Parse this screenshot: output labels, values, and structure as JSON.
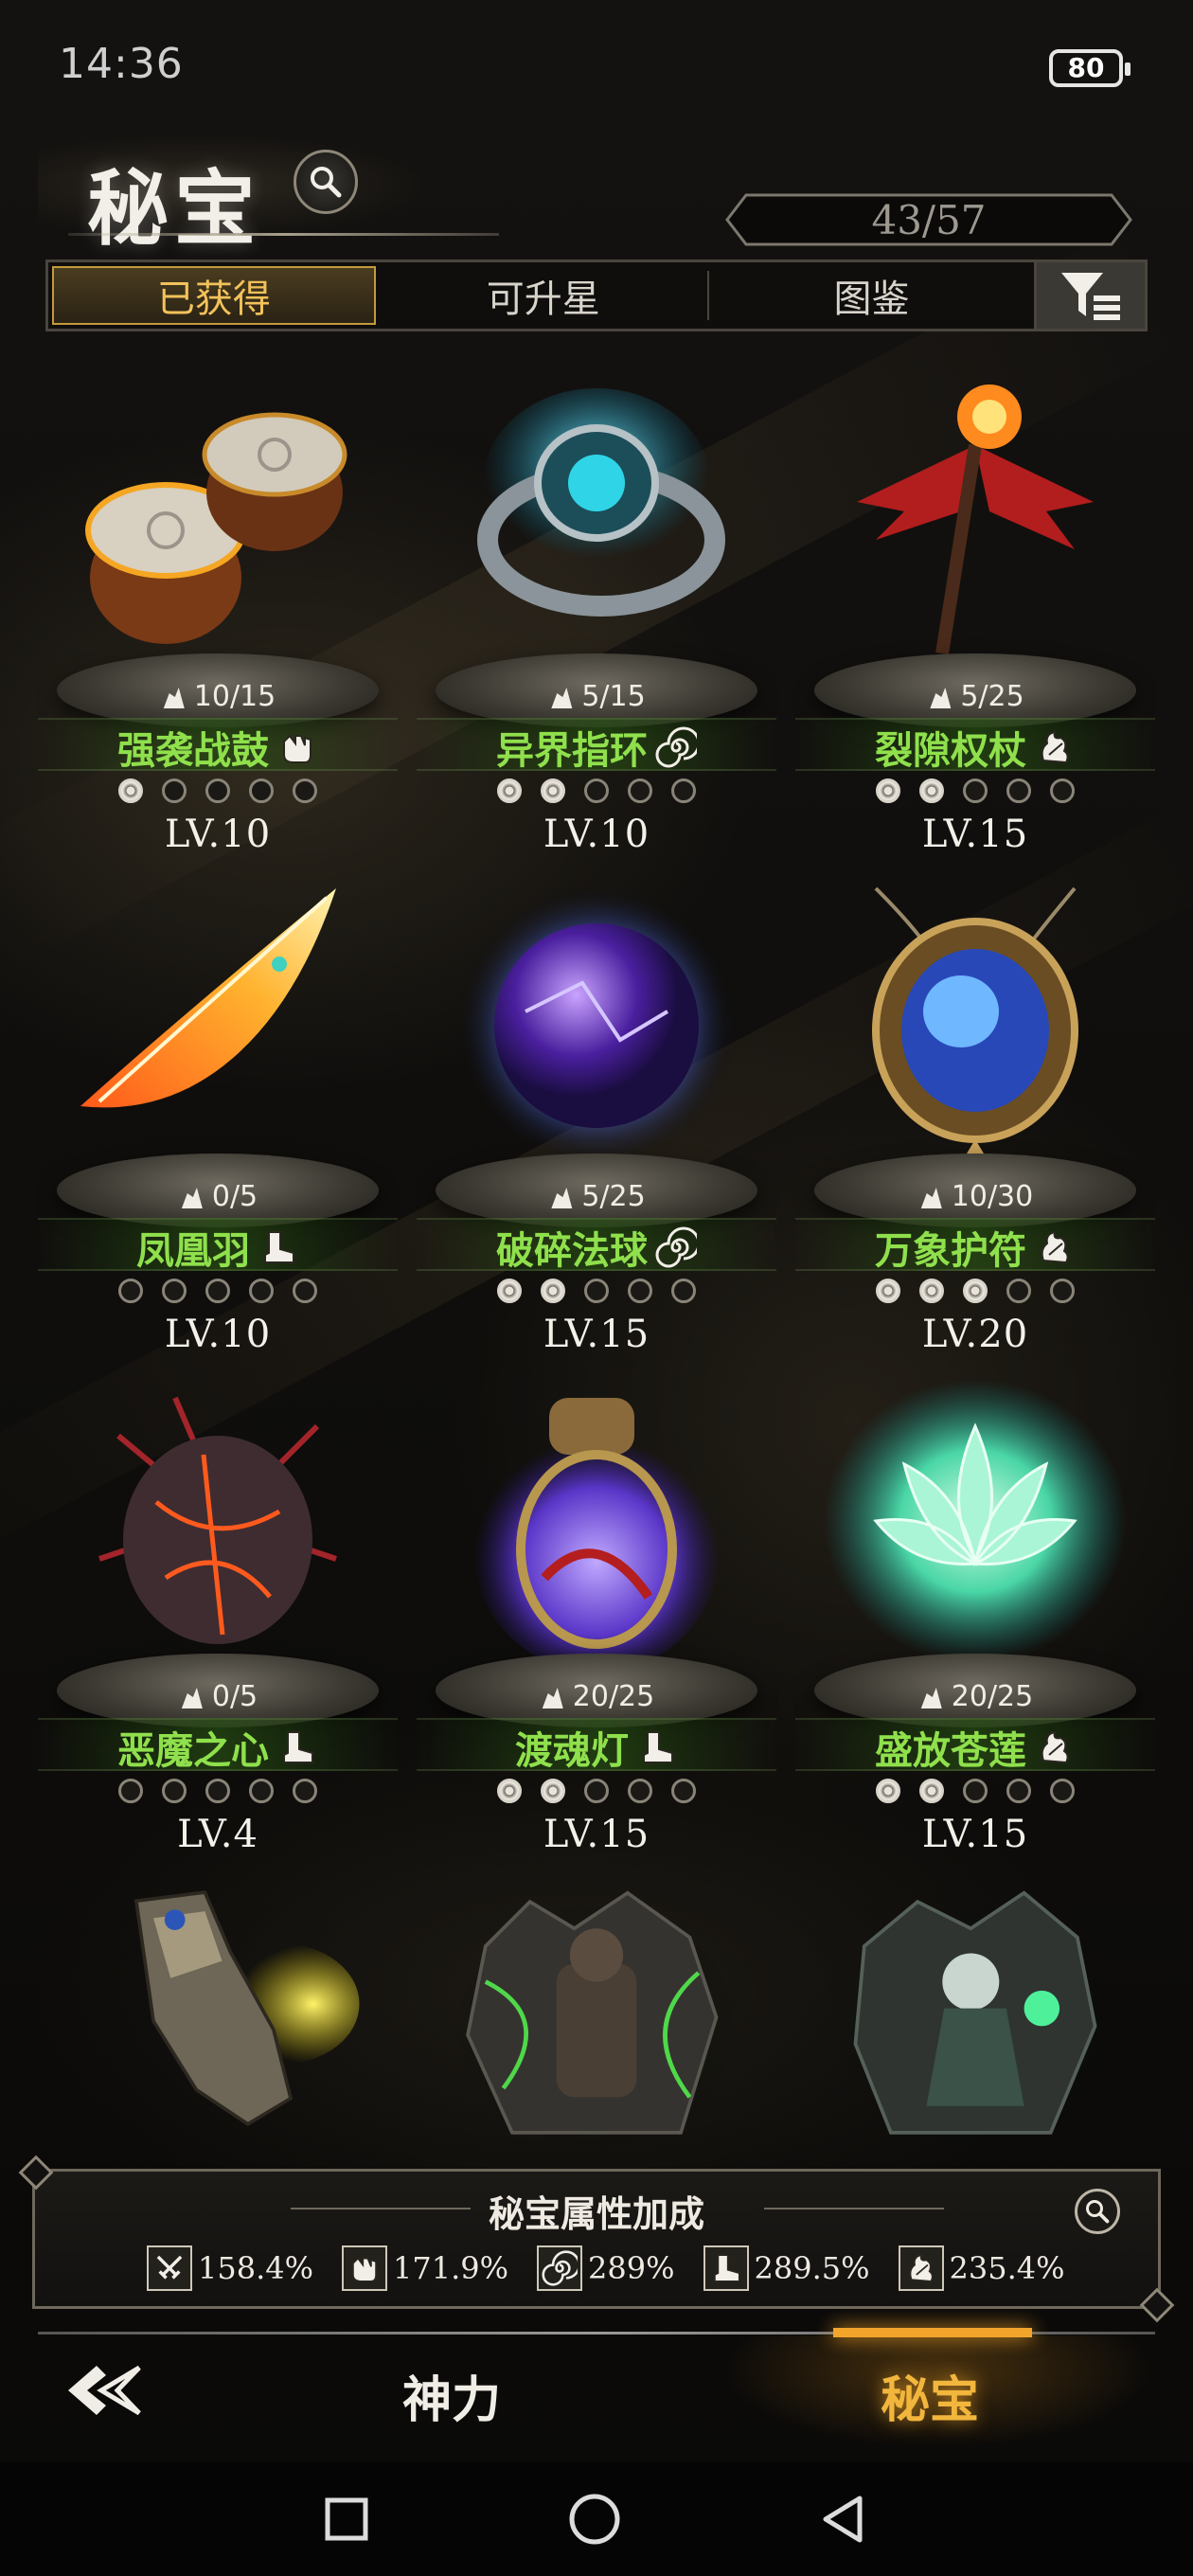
{
  "status_bar": {
    "time": "14:36",
    "battery": "80"
  },
  "header": {
    "title": "秘宝",
    "counter": "43/57"
  },
  "tabs": [
    {
      "label": "已获得",
      "active": true
    },
    {
      "label": "可升星",
      "active": false
    },
    {
      "label": "图鉴",
      "active": false
    }
  ],
  "items": [
    {
      "shards": "10/15",
      "name": "强袭战鼓",
      "class_icon": "fist-icon",
      "stars_on": 1,
      "level": "LV.10"
    },
    {
      "shards": "5/15",
      "name": "异界指环",
      "class_icon": "spiral-icon",
      "stars_on": 2,
      "level": "LV.10"
    },
    {
      "shards": "5/25",
      "name": "裂隙权杖",
      "class_icon": "fire-hand-icon",
      "stars_on": 2,
      "level": "LV.15"
    },
    {
      "shards": "0/5",
      "name": "凤凰羽",
      "class_icon": "boot-icon",
      "stars_on": 0,
      "level": "LV.10"
    },
    {
      "shards": "5/25",
      "name": "破碎法球",
      "class_icon": "spiral-icon",
      "stars_on": 2,
      "level": "LV.15"
    },
    {
      "shards": "10/30",
      "name": "万象护符",
      "class_icon": "fire-hand-icon",
      "stars_on": 3,
      "level": "LV.20"
    },
    {
      "shards": "0/5",
      "name": "恶魔之心",
      "class_icon": "boot-icon",
      "stars_on": 0,
      "level": "LV.4"
    },
    {
      "shards": "20/25",
      "name": "渡魂灯",
      "class_icon": "boot-icon",
      "stars_on": 2,
      "level": "LV.15"
    },
    {
      "shards": "20/25",
      "name": "盛放苍莲",
      "class_icon": "fire-hand-icon",
      "stars_on": 2,
      "level": "LV.15"
    }
  ],
  "bonus": {
    "title": "秘宝属性加成",
    "stats": [
      {
        "icon": "sword-icon",
        "value": "158.4%"
      },
      {
        "icon": "fist-icon",
        "value": "171.9%"
      },
      {
        "icon": "spiral-icon",
        "value": "289%"
      },
      {
        "icon": "boot-icon",
        "value": "289.5%"
      },
      {
        "icon": "fire-hand-icon",
        "value": "235.4%"
      }
    ]
  },
  "bottom_nav": {
    "items": [
      {
        "label": "神力"
      },
      {
        "label": "秘宝",
        "active": true
      }
    ]
  },
  "colors": {
    "accent": "#f2b63d",
    "item_name": "#8fe04c",
    "tab_active": "#f2c25a"
  }
}
